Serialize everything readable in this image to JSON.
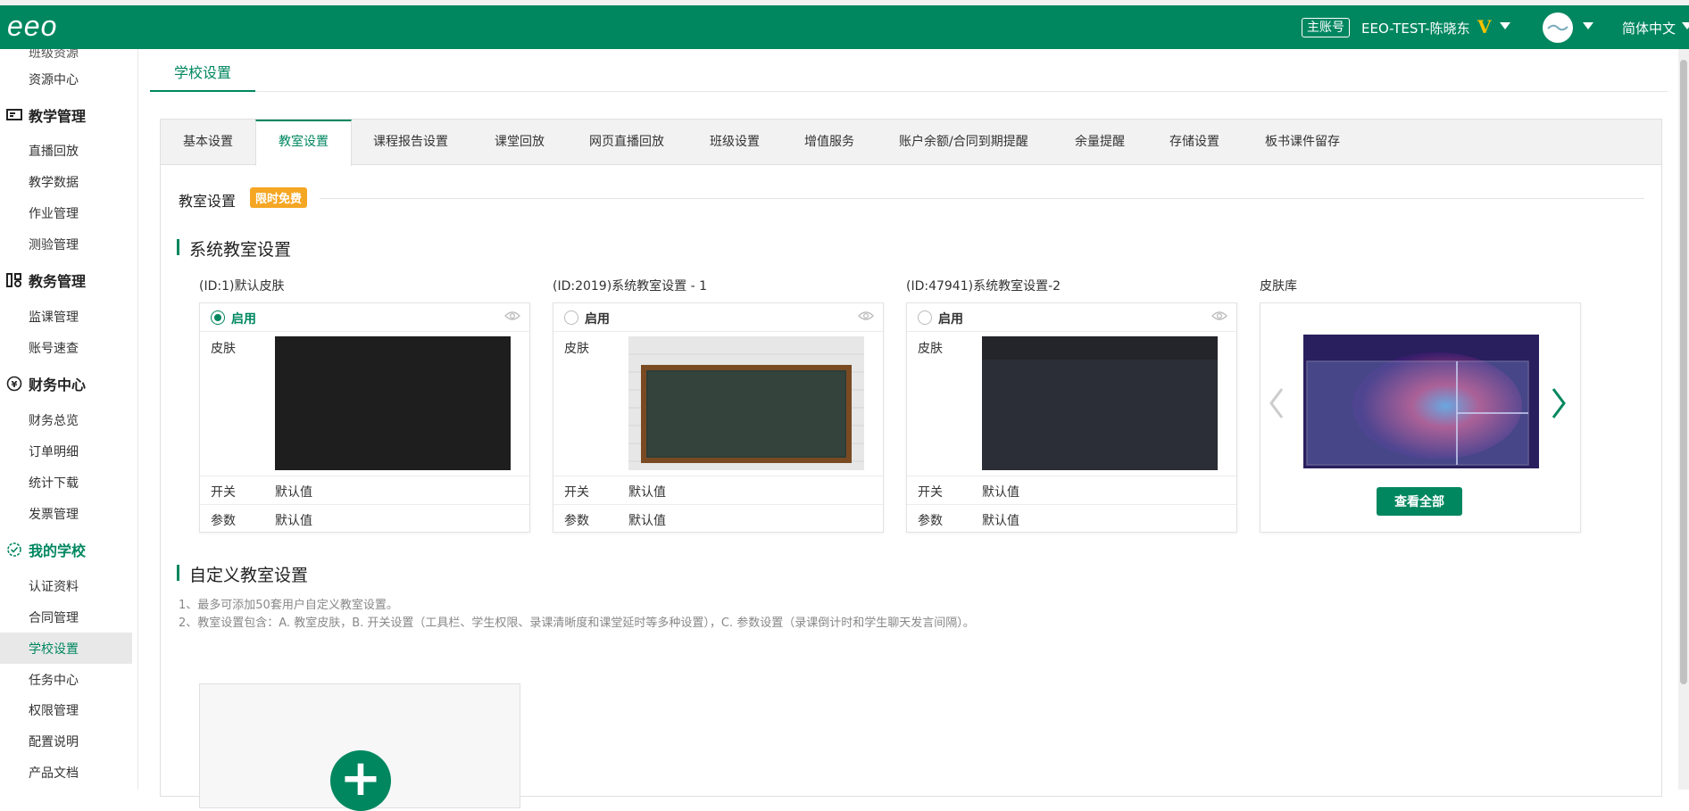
{
  "header": {
    "logo": "eeo",
    "account_badge": "主账号",
    "account_name": "EEO-TEST-陈晓东",
    "vip": "V",
    "language": "简体中文"
  },
  "sidebar": {
    "items": [
      {
        "label": "班级资源"
      },
      {
        "label": "资源中心"
      }
    ],
    "groups": [
      {
        "title": "教学管理",
        "icon": "monitor-icon",
        "items": [
          "直播回放",
          "教学数据",
          "作业管理",
          "测验管理"
        ]
      },
      {
        "title": "教务管理",
        "icon": "org-icon",
        "items": [
          "监课管理",
          "账号速查"
        ]
      },
      {
        "title": "财务中心",
        "icon": "yen-icon",
        "items": [
          "财务总览",
          "订单明细",
          "统计下载",
          "发票管理"
        ]
      },
      {
        "title": "我的学校",
        "icon": "school-gear-icon",
        "items": [
          "认证资料",
          "合同管理",
          "学校设置",
          "任务中心",
          "权限管理",
          "配置说明",
          "产品文档"
        ]
      }
    ],
    "active_item": "学校设置"
  },
  "main": {
    "tab": "学校设置",
    "tabs": [
      "基本设置",
      "教室设置",
      "课程报告设置",
      "课堂回放",
      "网页直播回放",
      "班级设置",
      "增值服务",
      "账户余额/合同到期提醒",
      "余量提醒",
      "存储设置",
      "板书课件留存"
    ],
    "active_tab": "教室设置",
    "section_title": "教室设置",
    "free_badge": "限时免费",
    "system_title": "系统教室设置",
    "custom_title": "自定义教室设置",
    "cards": [
      {
        "caption": "(ID:1)默认皮肤",
        "enable": "启用",
        "selected": true,
        "skin_label": "皮肤",
        "switch_label": "开关",
        "switch_value": "默认值",
        "param_label": "参数",
        "param_value": "默认值",
        "skin": "dark-black"
      },
      {
        "caption": "(ID:2019)系统教室设置 - 1",
        "enable": "启用",
        "selected": false,
        "skin_label": "皮肤",
        "switch_label": "开关",
        "switch_value": "默认值",
        "param_label": "参数",
        "param_value": "默认值",
        "skin": "chalkboard"
      },
      {
        "caption": "(ID:47941)系统教室设置-2",
        "enable": "启用",
        "selected": false,
        "skin_label": "皮肤",
        "switch_label": "开关",
        "switch_value": "默认值",
        "param_label": "参数",
        "param_value": "默认值",
        "skin": "dark-gray"
      }
    ],
    "library": {
      "caption": "皮肤库",
      "view_all": "查看全部"
    },
    "notes": [
      "1、最多可添加50套用户自定义教室设置。",
      "2、教室设置包含：A. 教室皮肤，B. 开关设置（工具栏、学生权限、录课清晰度和课堂延时等多种设置），C. 参数设置（录课倒计时和学生聊天发言间隔）。"
    ],
    "add_icon": "plus-icon"
  },
  "colors": {
    "brand": "#00875f",
    "badge": "#f5a623"
  }
}
